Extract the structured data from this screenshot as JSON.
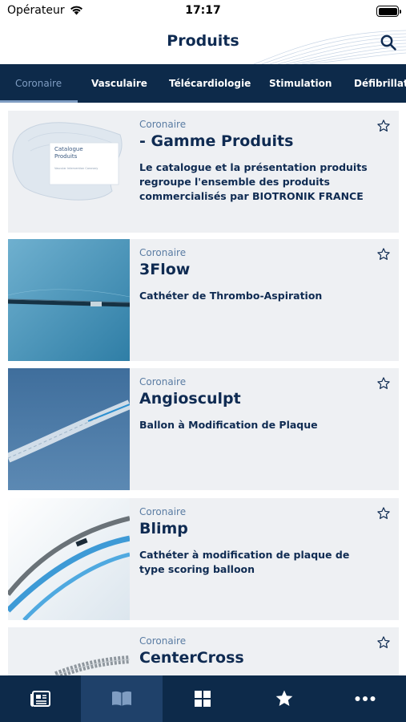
{
  "status": {
    "carrier": "Opérateur",
    "time": "17:17"
  },
  "header": {
    "title": "Produits"
  },
  "tabs": [
    {
      "label": "Coronaire",
      "active": true
    },
    {
      "label": "Vasculaire",
      "active": false
    },
    {
      "label": "Télécardiologie",
      "active": false
    },
    {
      "label": "Stimulation",
      "active": false
    },
    {
      "label": "Défibrillation",
      "active": false
    }
  ],
  "products": [
    {
      "category": "Coronaire",
      "name": "- Gamme Produits",
      "description": "Le catalogue et la présentation produits regroupe l'ensemble des produits commercialisés par BIOTRONIK FRANCE",
      "thumb_title": "Catalogue Produits",
      "thumb_caption": "Vascular Intervention Coronary",
      "favorite": false
    },
    {
      "category": "Coronaire",
      "name": "3Flow",
      "description": "Cathéter de Thrombo-Aspiration",
      "favorite": false
    },
    {
      "category": "Coronaire",
      "name": "Angiosculpt",
      "description": "Ballon à Modification de Plaque",
      "favorite": false
    },
    {
      "category": "Coronaire",
      "name": "Blimp",
      "description": "Cathéter à modification de plaque de type scoring balloon",
      "favorite": false
    },
    {
      "category": "Coronaire",
      "name": "CenterCross",
      "description": "",
      "favorite": false
    }
  ],
  "bottom_nav": [
    {
      "icon": "news-icon",
      "active": false
    },
    {
      "icon": "book-icon",
      "active": true
    },
    {
      "icon": "grid-icon",
      "active": false
    },
    {
      "icon": "star-icon",
      "active": false
    },
    {
      "icon": "more-icon",
      "active": false
    }
  ],
  "colors": {
    "navy": "#0d2a4a",
    "title_blue": "#0f2b52",
    "category_blue": "#5a7ca3",
    "card_bg": "#eef0f3",
    "active_tab": "#7f9dc2"
  }
}
